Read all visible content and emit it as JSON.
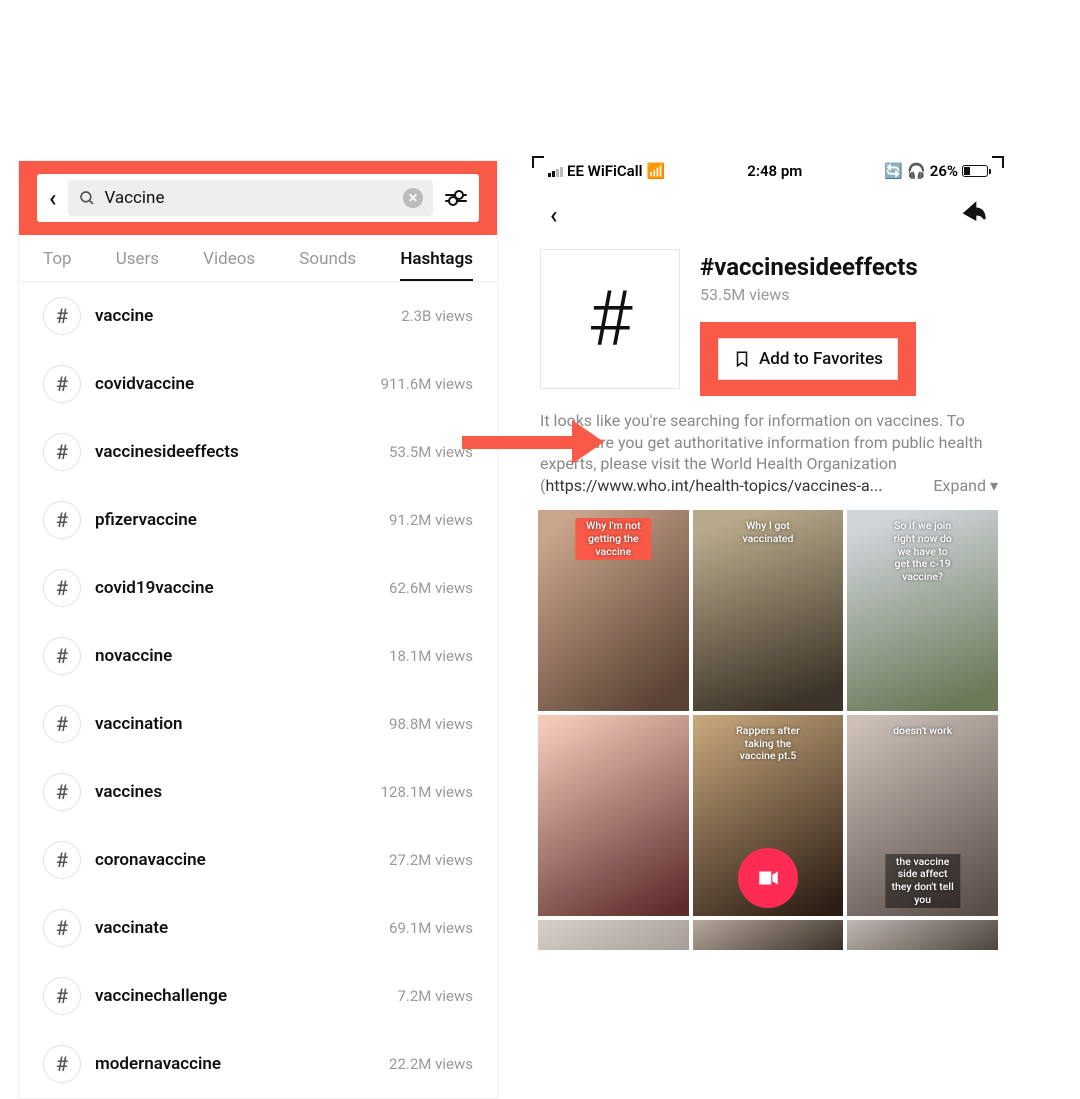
{
  "left": {
    "search_value": "Vaccine",
    "tabs": [
      "Top",
      "Users",
      "Videos",
      "Sounds",
      "Hashtags"
    ],
    "active_tab_index": 4,
    "results": [
      {
        "name": "vaccine",
        "views": "2.3B views"
      },
      {
        "name": "covidvaccine",
        "views": "911.6M views"
      },
      {
        "name": "vaccinesideeffects",
        "views": "53.5M views"
      },
      {
        "name": "pfizervaccine",
        "views": "91.2M views"
      },
      {
        "name": "covid19vaccine",
        "views": "62.6M views"
      },
      {
        "name": "novaccine",
        "views": "18.1M views"
      },
      {
        "name": "vaccination",
        "views": "98.8M views"
      },
      {
        "name": "vaccines",
        "views": "128.1M views"
      },
      {
        "name": "coronavaccine",
        "views": "27.2M views"
      },
      {
        "name": "vaccinate",
        "views": "69.1M views"
      },
      {
        "name": "vaccinechallenge",
        "views": "7.2M views"
      },
      {
        "name": "modernavaccine",
        "views": "22.2M views"
      }
    ]
  },
  "right": {
    "status": {
      "carrier": "EE WiFiCall",
      "time": "2:48 pm",
      "battery": "26%"
    },
    "hashtag_title": "#vaccinesideeffects",
    "hashtag_views": "53.5M views",
    "favorites_label": "Add to Favorites",
    "notice_line1": "It looks like you're searching for information on vaccines.",
    "notice_line2": "To make sure you get authoritative information from public health experts, please visit the World Health Organization (",
    "notice_link": "https://www.who.int/health-topics/vaccines-a...",
    "expand_label": "Expand",
    "videos": [
      {
        "caption": "Why I'm not getting the vaccine",
        "pos": "top",
        "style": "red"
      },
      {
        "caption": "Why I got vaccinated",
        "pos": "top",
        "style": "plain"
      },
      {
        "caption": "So if we join right now do we have to get the c-19 vaccine?",
        "pos": "top",
        "style": "plain"
      },
      {
        "caption": "",
        "pos": "",
        "style": ""
      },
      {
        "caption": "Rappers after taking the vaccine pt.5",
        "pos": "top",
        "style": "plain",
        "record": true
      },
      {
        "caption": "doesn't work",
        "pos": "top",
        "style": "plain",
        "caption2": "the vaccine side affect they don't tell you"
      }
    ]
  }
}
